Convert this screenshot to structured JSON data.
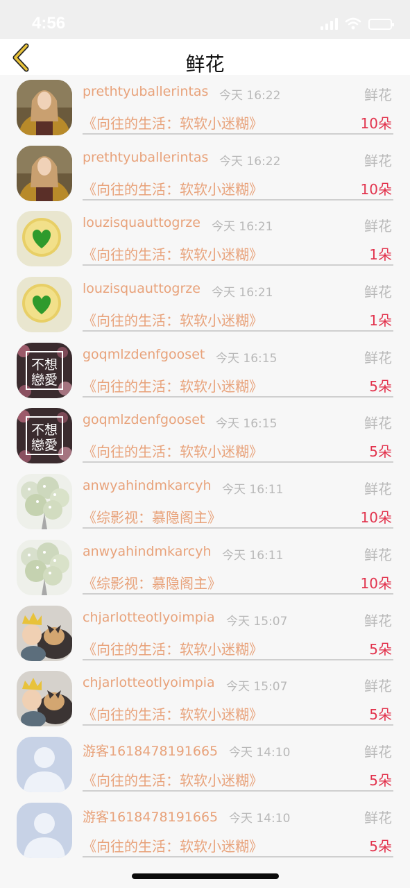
{
  "status_bar": {
    "time": "4:56"
  },
  "nav": {
    "title": "鲜花"
  },
  "rows": [
    {
      "username": "prethtyuballerintas",
      "time": "今天 16:22",
      "type": "鲜花",
      "book": "《向往的生活：软软小迷糊》",
      "count": "10朵",
      "avatar": "woman-avatar"
    },
    {
      "username": "prethtyuballerintas",
      "time": "今天 16:22",
      "type": "鲜花",
      "book": "《向往的生活：软软小迷糊》",
      "count": "10朵",
      "avatar": "woman-avatar"
    },
    {
      "username": "louzisquauttogrze",
      "time": "今天 16:21",
      "type": "鲜花",
      "book": "《向往的生活：软软小迷糊》",
      "count": "1朵",
      "avatar": "heart-avatar"
    },
    {
      "username": "louzisquauttogrze",
      "time": "今天 16:21",
      "type": "鲜花",
      "book": "《向往的生活：软软小迷糊》",
      "count": "1朵",
      "avatar": "heart-avatar"
    },
    {
      "username": "goqmlzdenfgooset",
      "time": "今天 16:15",
      "type": "鲜花",
      "book": "《向往的生活：软软小迷糊》",
      "count": "5朵",
      "avatar": "text-avatar",
      "avatar_text": [
        "不想",
        "戀愛"
      ]
    },
    {
      "username": "goqmlzdenfgooset",
      "time": "今天 16:15",
      "type": "鲜花",
      "book": "《向往的生活：软软小迷糊》",
      "count": "5朵",
      "avatar": "text-avatar",
      "avatar_text": [
        "不想",
        "戀愛"
      ]
    },
    {
      "username": "anwyahindmkarcyh",
      "time": "今天 16:11",
      "type": "鲜花",
      "book": "《综影视：慕隐阁主》",
      "count": "10朵",
      "avatar": "flower-avatar"
    },
    {
      "username": "anwyahindmkarcyh",
      "time": "今天 16:11",
      "type": "鲜花",
      "book": "《综影视：慕隐阁主》",
      "count": "10朵",
      "avatar": "flower-avatar"
    },
    {
      "username": "chjarlotteotlyoimpia",
      "time": "今天 15:07",
      "type": "鲜花",
      "book": "《向往的生活：软软小迷糊》",
      "count": "5朵",
      "avatar": "dog-avatar"
    },
    {
      "username": "chjarlotteotlyoimpia",
      "time": "今天 15:07",
      "type": "鲜花",
      "book": "《向往的生活：软软小迷糊》",
      "count": "5朵",
      "avatar": "dog-avatar"
    },
    {
      "username": "游客1618478191665",
      "time": "今天 14:10",
      "type": "鲜花",
      "book": "《向往的生活：软软小迷糊》",
      "count": "5朵",
      "avatar": "default-avatar"
    },
    {
      "username": "游客1618478191665",
      "time": "今天 14:10",
      "type": "鲜花",
      "book": "《向往的生活：软软小迷糊》",
      "count": "5朵",
      "avatar": "default-avatar"
    }
  ],
  "colors": {
    "accent": "#e8a27a",
    "count": "#e2334d",
    "muted": "#b8b8b8",
    "back_arrow": "#e8c23a"
  }
}
